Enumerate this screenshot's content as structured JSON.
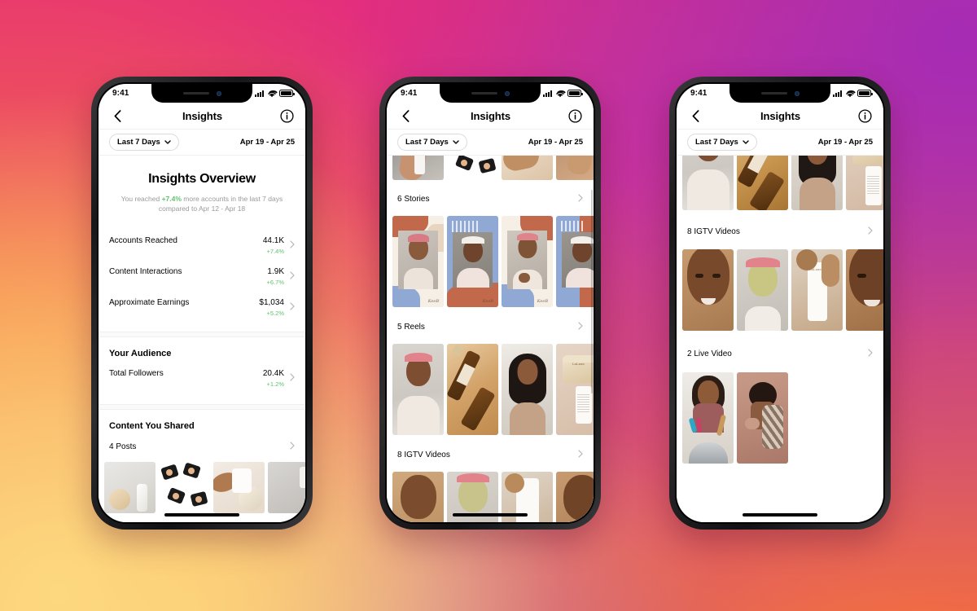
{
  "background": {
    "gradient_colors": [
      "#e62a7b",
      "#ef4a5f",
      "#f7773f",
      "#fbd07a",
      "#a32cb5"
    ],
    "style": "instagram-brand-gradient"
  },
  "status_bar": {
    "time": "9:41",
    "signal_icon": "cellular-signal-icon",
    "wifi_icon": "wifi-icon",
    "battery_icon": "battery-full-icon"
  },
  "nav": {
    "back_icon": "back-chevron-icon",
    "title": "Insights",
    "info_icon": "info-circle-icon"
  },
  "filter": {
    "range_label": "Last 7 Days",
    "chevron_icon": "chevron-down-icon",
    "date_range": "Apr 19 - Apr 25"
  },
  "accent": {
    "positive": "#5ec46b",
    "muted": "#9a9a9a",
    "divider": "#efefef"
  },
  "phones": [
    {
      "id": "phone-overview",
      "overview": {
        "title": "Insights Overview",
        "summary_prefix": "You reached ",
        "summary_delta": "+7.4%",
        "summary_suffix": " more accounts in the last 7 days compared to Apr 12 - Apr 18"
      },
      "metrics": [
        {
          "label": "Accounts Reached",
          "value": "44.1K",
          "delta": "+7.4%"
        },
        {
          "label": "Content Interactions",
          "value": "1.9K",
          "delta": "+6.7%"
        },
        {
          "label": "Approximate Earnings",
          "value": "$1,034",
          "delta": "+5.2%"
        }
      ],
      "audience": {
        "heading": "Your Audience",
        "rows": [
          {
            "label": "Total Followers",
            "value": "20.4K",
            "delta": "+1.2%"
          }
        ]
      },
      "content_shared": {
        "heading": "Content You Shared",
        "rows": [
          {
            "label": "4 Posts"
          }
        ]
      }
    },
    {
      "id": "phone-stories-reels",
      "sections": [
        {
          "label": "6 Stories",
          "kind": "story",
          "count": 4
        },
        {
          "label": "5 Reels",
          "kind": "reel",
          "count": 4
        },
        {
          "label": "8 IGTV Videos",
          "kind": "igtv",
          "count": 4
        }
      ]
    },
    {
      "id": "phone-igtv-live",
      "sections": [
        {
          "label": "8 IGTV Videos",
          "kind": "igtv",
          "count": 4
        },
        {
          "label": "2 Live Video",
          "kind": "live",
          "count": 2
        }
      ]
    }
  ]
}
